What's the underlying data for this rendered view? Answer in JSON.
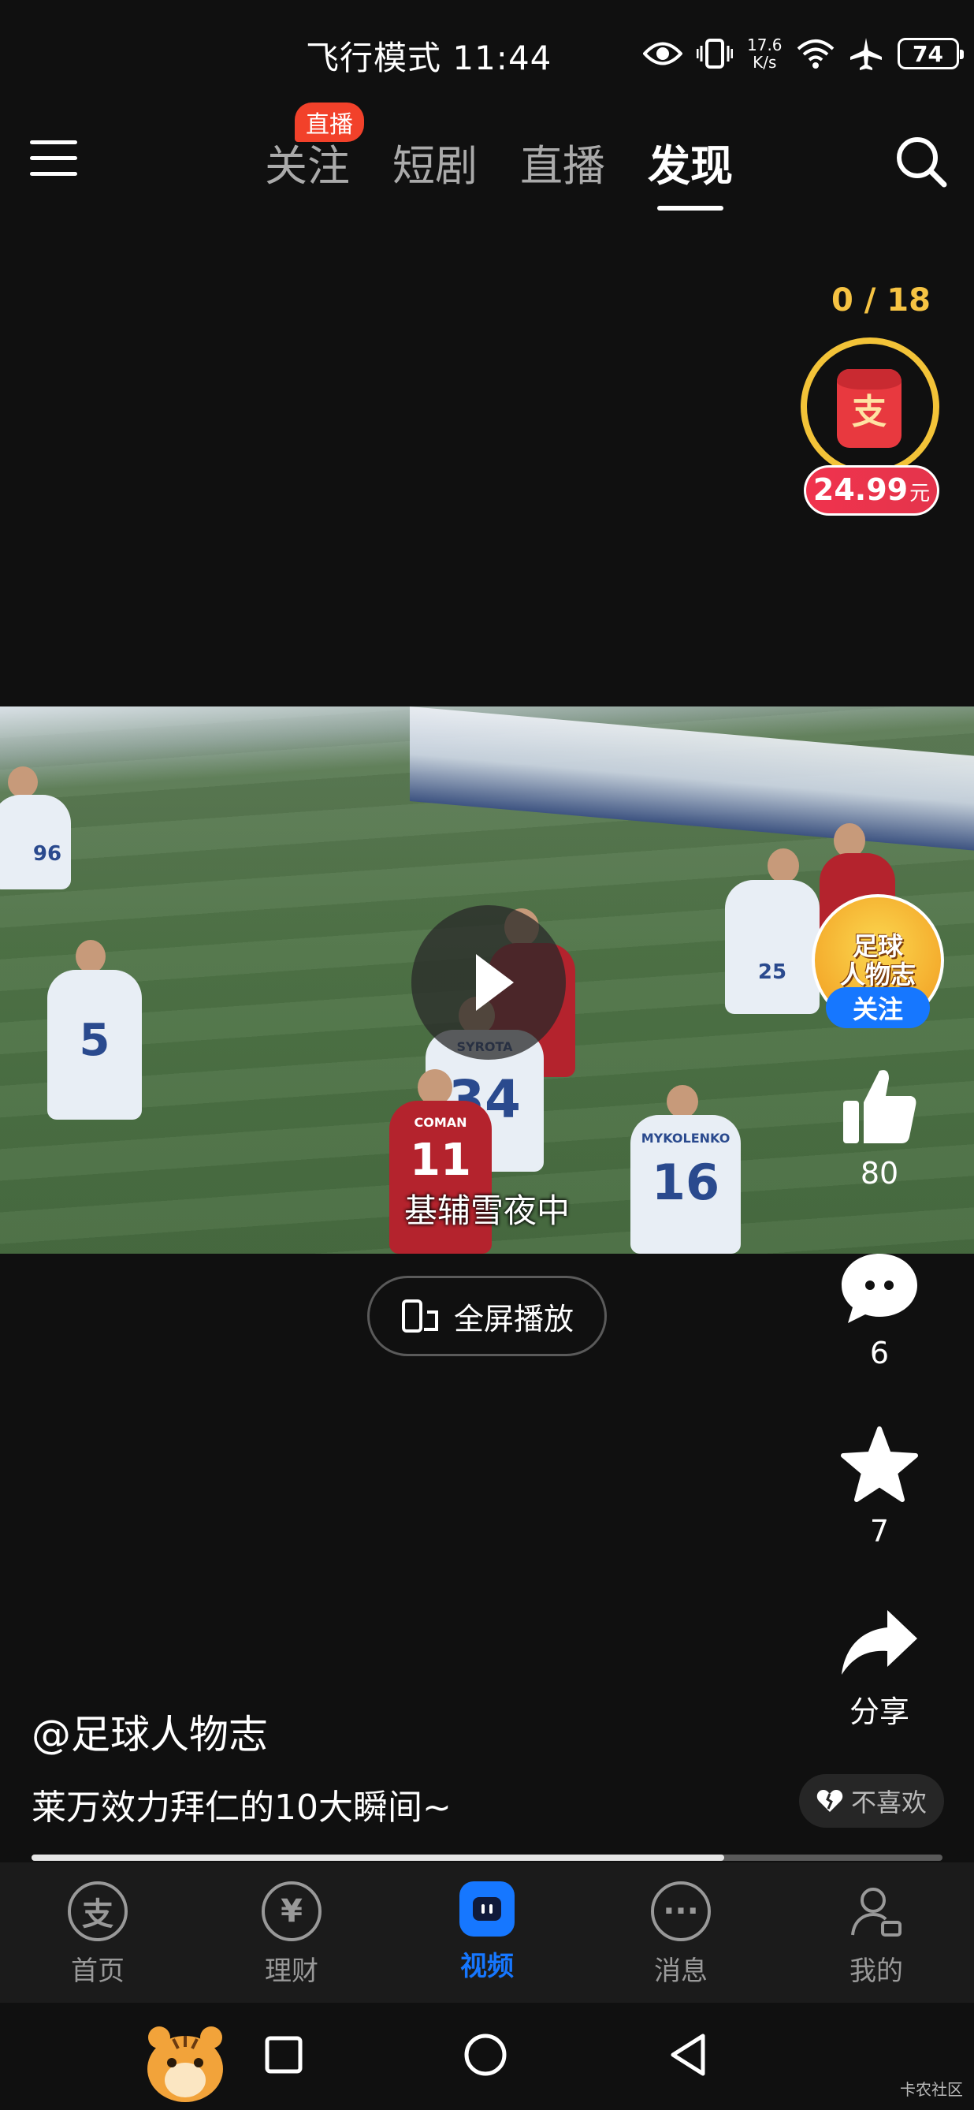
{
  "status_bar": {
    "time_text": "飞行模式 11:44",
    "net_speed_value": "17.6",
    "net_speed_unit": "K/s",
    "battery": "74",
    "icons": [
      "eye-icon",
      "vibrate-icon",
      "wifi-icon",
      "airplane-icon",
      "battery-icon"
    ]
  },
  "top_nav": {
    "tabs": [
      {
        "label": "关注",
        "active": false
      },
      {
        "label": "短剧",
        "active": false
      },
      {
        "label": "直播",
        "active": false
      },
      {
        "label": "发现",
        "active": true
      }
    ],
    "live_badge": "直播",
    "icons": [
      "menu-icon",
      "search-icon"
    ]
  },
  "reward": {
    "progress": "0 / 18",
    "envelope_char": "支",
    "amount": "24.99",
    "unit": "元"
  },
  "video": {
    "subtitle": "基辅雪夜中",
    "fullscreen_label": "全屏播放",
    "progress_fraction": 0.76,
    "jersey_numbers": [
      "96",
      "5",
      "34",
      "11",
      "16",
      "25"
    ],
    "jersey_names": [
      "SYROTA",
      "COMAN",
      "MYKOLENKO"
    ]
  },
  "creator": {
    "avatar_text_line1": "足球",
    "avatar_text_line2": "人物志",
    "follow_label": "关注"
  },
  "actions": {
    "like_count": "80",
    "comment_count": "6",
    "favorite_count": "7",
    "share_label": "分享"
  },
  "post": {
    "author": "@足球人物志",
    "description": "莱万效力拜仁的10大瞬间~",
    "dislike_label": "不喜欢"
  },
  "bottom_tabs": [
    {
      "label": "首页",
      "glyph": "支",
      "active": false
    },
    {
      "label": "理财",
      "glyph": "¥",
      "active": false
    },
    {
      "label": "视频",
      "glyph": "",
      "active": true
    },
    {
      "label": "消息",
      "glyph": "···",
      "active": false
    },
    {
      "label": "我的",
      "glyph": "",
      "active": false
    }
  ],
  "watermark": "卡农社区",
  "colors": {
    "accent_blue": "#1677ff",
    "reward_gold": "#f3c338",
    "reward_red": "#e8393f",
    "live_red": "#f2412a"
  }
}
